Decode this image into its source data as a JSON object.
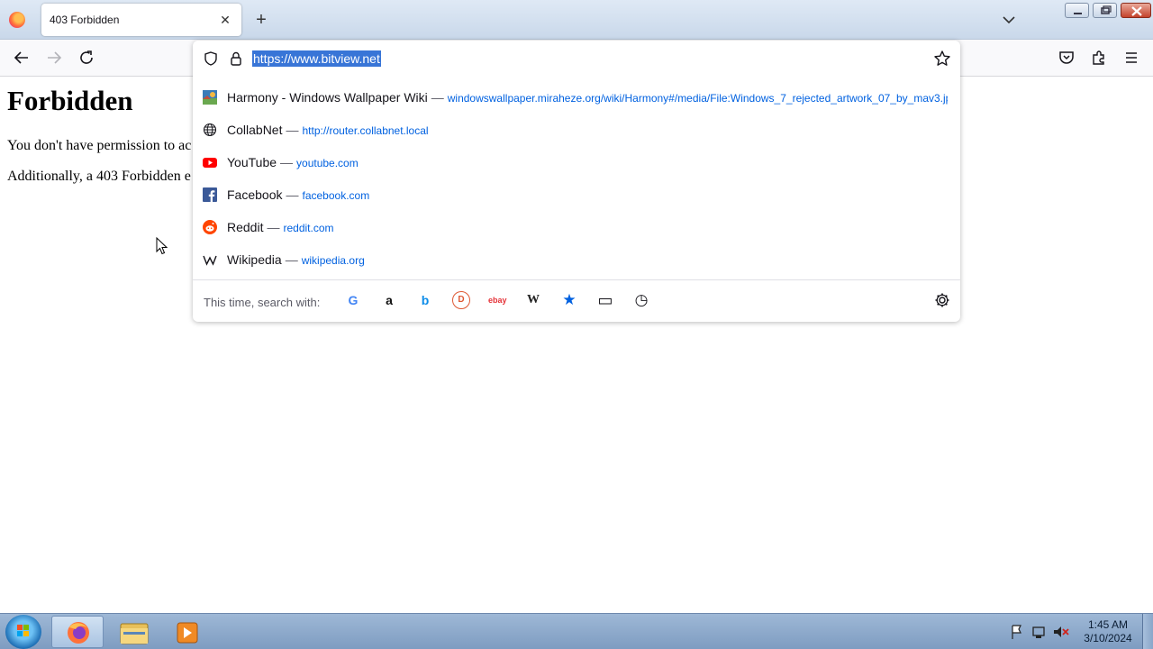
{
  "browser": {
    "tab_title": "403 Forbidden",
    "tab_close_glyph": "✕",
    "new_tab_glyph": "+"
  },
  "urlbar": {
    "url": "https://www.bitview.net",
    "results": [
      {
        "title": "Harmony - Windows Wallpaper Wiki",
        "url": "windowswallpaper.miraheze.org/wiki/Harmony#/media/File:Windows_7_rejected_artwork_07_by_mav3.jp",
        "icon": "wallpaper-thumbnail-icon"
      },
      {
        "title": "CollabNet",
        "url": "http://router.collabnet.local",
        "icon": "globe-icon"
      },
      {
        "title": "YouTube",
        "url": "youtube.com",
        "icon": "youtube-icon"
      },
      {
        "title": "Facebook",
        "url": "facebook.com",
        "icon": "facebook-icon"
      },
      {
        "title": "Reddit",
        "url": "reddit.com",
        "icon": "reddit-icon"
      },
      {
        "title": "Wikipedia",
        "url": "wikipedia.org",
        "icon": "wikipedia-icon"
      }
    ],
    "separator": "—",
    "search_with_label": "This time, search with:",
    "engines": [
      {
        "name": "google-icon",
        "glyph": "G",
        "color": "#4285f4"
      },
      {
        "name": "amazon-icon",
        "glyph": "a",
        "color": "#111111"
      },
      {
        "name": "bing-icon",
        "glyph": "b",
        "color": "#0c8ce9"
      },
      {
        "name": "duckduckgo-icon",
        "glyph": "D",
        "color": "#de5833"
      },
      {
        "name": "ebay-icon",
        "glyph": "ebay",
        "color": "#e53238"
      },
      {
        "name": "wikipedia-icon",
        "glyph": "W",
        "color": "#222222"
      },
      {
        "name": "bookmarks-icon",
        "glyph": "★",
        "color": "#0061e0"
      },
      {
        "name": "tabs-icon",
        "glyph": "▭",
        "color": "#15141a"
      },
      {
        "name": "history-icon",
        "glyph": "◷",
        "color": "#15141a"
      }
    ]
  },
  "page": {
    "heading": "Forbidden",
    "para1": "You don't have permission to ac",
    "para2": "Additionally, a 403 Forbidden e"
  },
  "taskbar": {
    "time": "1:45 AM",
    "date": "3/10/2024"
  },
  "colors": {
    "accent": "#0061e0",
    "selection": "#3875d7"
  }
}
